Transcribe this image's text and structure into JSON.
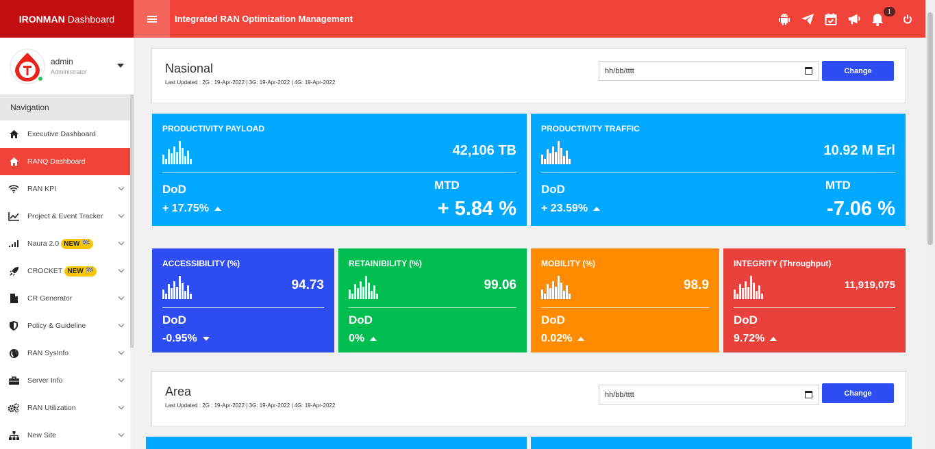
{
  "brand": {
    "strong": "IRONMAN",
    "rest": "Dashboard"
  },
  "header": {
    "title": "Integrated RAN Optimization Management",
    "notification_count": "1"
  },
  "user": {
    "name": "admin",
    "role": "Administrator"
  },
  "nav": {
    "header": "Navigation",
    "items": [
      {
        "label": "Executive Dashboard",
        "icon": "home-icon"
      },
      {
        "label": "RANQ Dashboard",
        "icon": "home-icon"
      },
      {
        "label": "RAN KPI",
        "icon": "wifi-icon"
      },
      {
        "label": "Project & Event Tracker",
        "icon": "line-chart-icon"
      },
      {
        "label": "Naura 2.0",
        "icon": "signal-icon",
        "badge": "NEW 🏁"
      },
      {
        "label": "CROCKET",
        "icon": "rocket-icon",
        "badge": "NEW 🏁"
      },
      {
        "label": "CR Generator",
        "icon": "file-icon"
      },
      {
        "label": "Policy & Guideline",
        "icon": "shield-icon"
      },
      {
        "label": "RAN SysInfo",
        "icon": "globe-icon"
      },
      {
        "label": "Server Info",
        "icon": "briefcase-icon"
      },
      {
        "label": "RAN Utilization",
        "icon": "cogs-icon"
      },
      {
        "label": "New Site",
        "icon": "sitemap-icon"
      }
    ]
  },
  "nasional": {
    "title": "Nasional",
    "last_updated": "Last Updated : 2G : 19-Apr-2022 | 3G: 19-Apr-2022 | 4G: 19-Apr-2022",
    "date_placeholder": "hh/bb/tttt",
    "change_label": "Change"
  },
  "cards_top": [
    {
      "title": "PRODUCTIVITY PAYLOAD",
      "value": "42,106 TB",
      "dod_label": "DoD",
      "dod_value": "+ 17.75%",
      "dod_trend": "up",
      "mtd_label": "MTD",
      "mtd_value": "+ 5.84 %",
      "color": "#00a8ff"
    },
    {
      "title": "PRODUCTIVITY TRAFFIC",
      "value": "10.92 M Erl",
      "dod_label": "DoD",
      "dod_value": "+ 23.59%",
      "dod_trend": "up",
      "mtd_label": "MTD",
      "mtd_value": "-7.06 %",
      "color": "#00a8ff"
    }
  ],
  "cards_kpi": [
    {
      "title": "ACCESSIBILITY (%)",
      "value": "94.73",
      "dod_label": "DoD",
      "dod_value": "-0.95%",
      "dod_trend": "down",
      "color": "#2d4df2"
    },
    {
      "title": "RETAINIBILITY (%)",
      "value": "99.06",
      "dod_label": "DoD",
      "dod_value": "0%",
      "dod_trend": "up",
      "color": "#00bd4f"
    },
    {
      "title": "MOBILITY (%)",
      "value": "98.9",
      "dod_label": "DoD",
      "dod_value": "0.02%",
      "dod_trend": "up",
      "color": "#ff8c00"
    },
    {
      "title": "INTEGRITY (Throughput)",
      "value": "11,919,075",
      "dod_label": "DoD",
      "dod_value": "9.72%",
      "dod_trend": "up",
      "color": "#e8403a"
    }
  ],
  "area": {
    "title": "Area",
    "last_updated": "Last Updated : 2G : 19-Apr-2022 | 3G: 19-Apr-2022 | 4G: 19-Apr-2022",
    "date_placeholder": "hh/bb/tttt",
    "change_label": "Change"
  }
}
